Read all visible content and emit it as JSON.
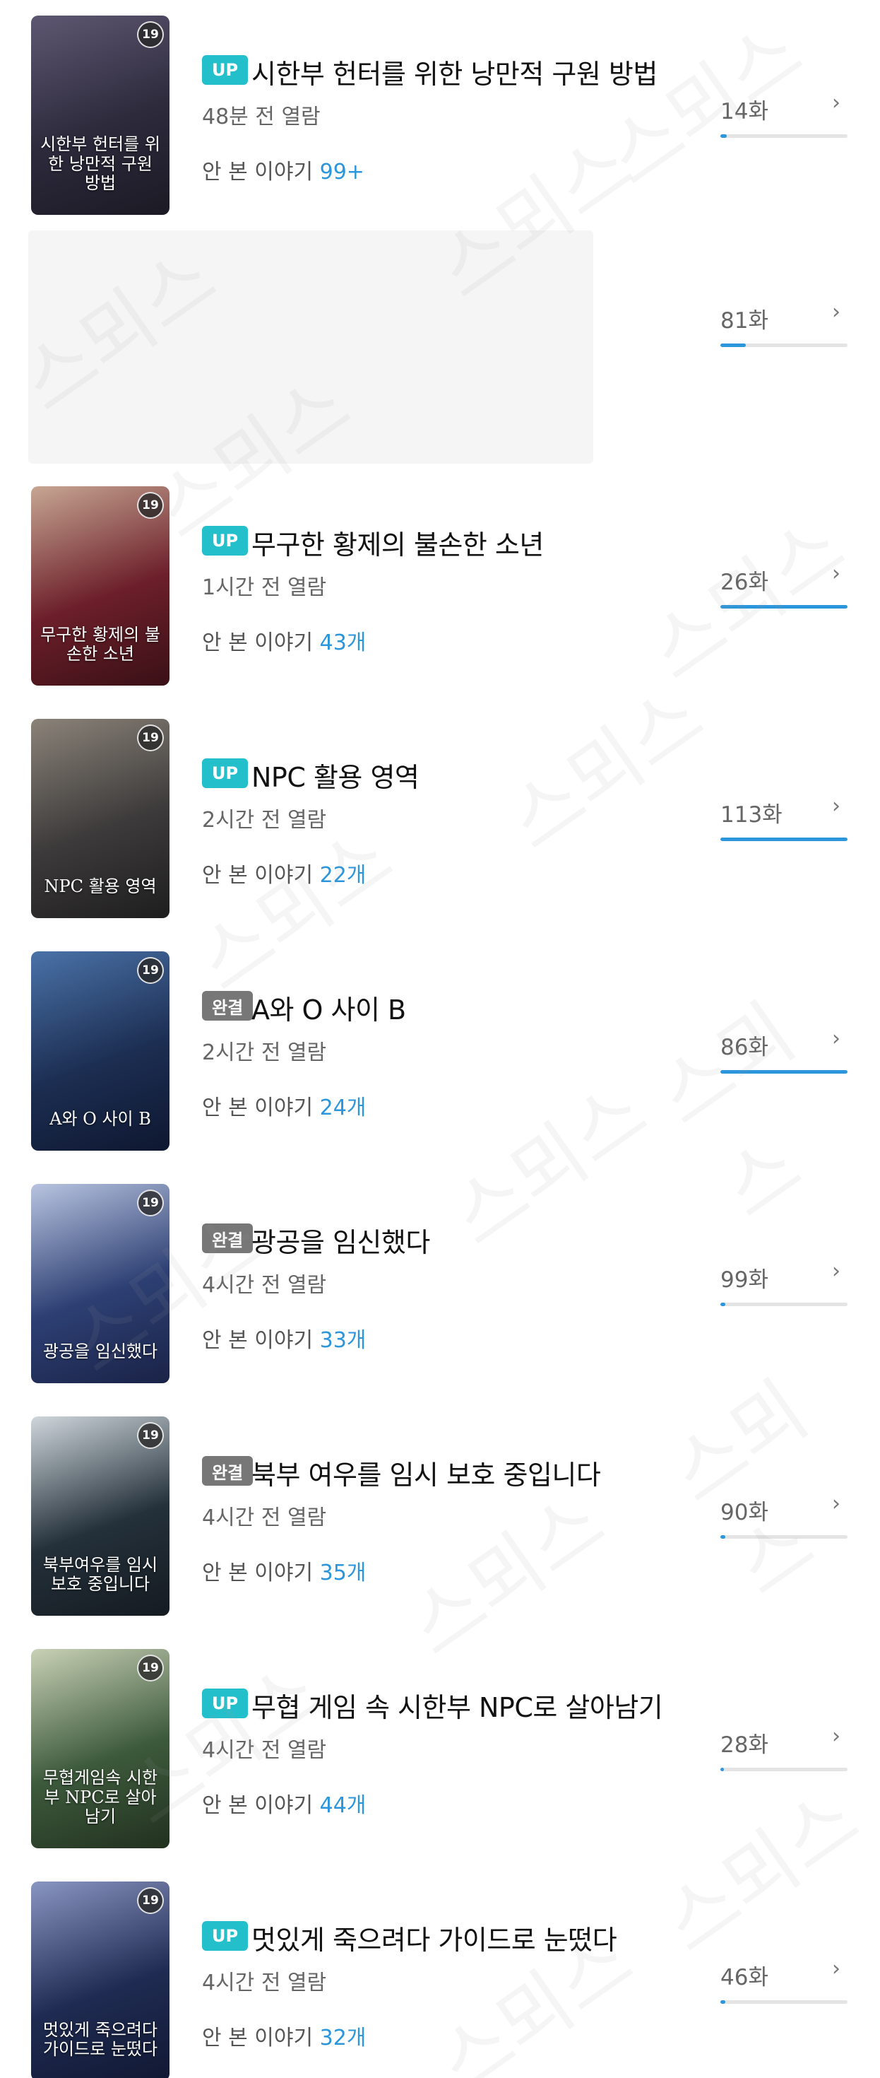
{
  "items": [
    {
      "badge": "UP",
      "title": "시한부 헌터를 위한 낭만적 구원 방법",
      "time": "48분 전 열람",
      "unread_label": "안 본 이야기",
      "unread": "99+",
      "episode": "14화",
      "progress": 0.05,
      "age": "19",
      "cover_text": "시한부 헌터를 위한 낭만적 구원 방법",
      "cover_colors": [
        "#2d2a3c",
        "#5e5772",
        "#1b1a24"
      ]
    },
    {
      "badge": "",
      "title": "",
      "time": "",
      "unread_label": "",
      "unread": "",
      "episode": "81화",
      "progress": 0.2,
      "age": "",
      "cover_text": "",
      "cover_colors": []
    },
    {
      "badge": "UP",
      "title": "무구한 황제의 불손한 소년",
      "time": "1시간 전 열람",
      "unread_label": "안 본 이야기",
      "unread": "43개",
      "episode": "26화",
      "progress": 1.0,
      "age": "19",
      "cover_text": "무구한 황제의 불손한 소년",
      "cover_colors": [
        "#6c1f2a",
        "#c7a693",
        "#3a1016"
      ]
    },
    {
      "badge": "UP",
      "title": "NPC 활용 영역",
      "time": "2시간 전 열람",
      "unread_label": "안 본 이야기",
      "unread": "22개",
      "episode": "113화",
      "progress": 1.0,
      "age": "19",
      "cover_text": "NPC 활용 영역",
      "cover_colors": [
        "#3c3a3a",
        "#8b8379",
        "#1f1e1e"
      ]
    },
    {
      "badge": "완결",
      "title": "A와 O 사이 B",
      "time": "2시간 전 열람",
      "unread_label": "안 본 이야기",
      "unread": "24개",
      "episode": "86화",
      "progress": 1.0,
      "age": "19",
      "cover_text": "A와 O 사이 B",
      "cover_colors": [
        "#1c2e52",
        "#4a72a8",
        "#0e1730"
      ]
    },
    {
      "badge": "완결",
      "title": "광공을 임신했다",
      "time": "4시간 전 열람",
      "unread_label": "안 본 이야기",
      "unread": "33개",
      "episode": "99화",
      "progress": 0.04,
      "age": "19",
      "cover_text": "광공을 임신했다",
      "cover_colors": [
        "#2d3f73",
        "#b8c4e0",
        "#1a2347"
      ]
    },
    {
      "badge": "완결",
      "title": "북부 여우를 임시 보호 중입니다",
      "time": "4시간 전 열람",
      "unread_label": "안 본 이야기",
      "unread": "35개",
      "episode": "90화",
      "progress": 0.04,
      "age": "19",
      "cover_text": "북부여우를 임시보호 중입니다",
      "cover_colors": [
        "#24303a",
        "#cfd7dc",
        "#151b21"
      ]
    },
    {
      "badge": "UP",
      "title": "무협 게임 속 시한부 NPC로 살아남기",
      "time": "4시간 전 열람",
      "unread_label": "안 본 이야기",
      "unread": "44개",
      "episode": "28화",
      "progress": 0.03,
      "age": "19",
      "cover_text": "무협게임속 시한부 NPC로 살아남기",
      "cover_colors": [
        "#3d5a3c",
        "#c9d1b6",
        "#22311f"
      ]
    },
    {
      "badge": "UP",
      "title": "멋있게 죽으려다 가이드로 눈떴다",
      "time": "4시간 전 열람",
      "unread_label": "안 본 이야기",
      "unread": "32개",
      "episode": "46화",
      "progress": 0.04,
      "age": "19",
      "cover_text": "멋있게 죽으려다 가이드로 눈떴다",
      "cover_colors": [
        "#1f2b52",
        "#8a96c2",
        "#111833"
      ]
    }
  ],
  "chevron_glyph": "›",
  "watermark": "스뫼스"
}
